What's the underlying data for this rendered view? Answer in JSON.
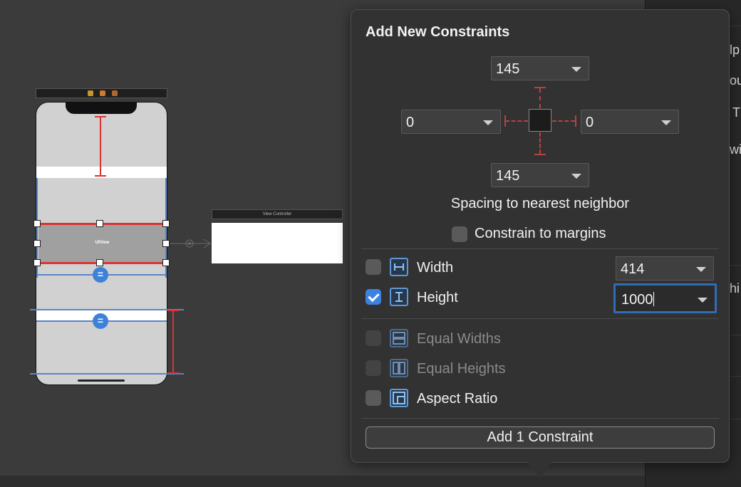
{
  "storyboard": {
    "uiview_label": "UIView",
    "view_controller_title": "View Controller",
    "equal_symbol": "="
  },
  "right_panel": {
    "fragments": [
      "lp",
      "ou",
      "T",
      "wi",
      "hi"
    ]
  },
  "popover": {
    "title": "Add New Constraints",
    "spacing": {
      "top": "145",
      "left": "0",
      "right": "0",
      "bottom": "145"
    },
    "spacing_caption": "Spacing to nearest neighbor",
    "constrain_to_margins": {
      "label": "Constrain to margins",
      "checked": false
    },
    "width": {
      "label": "Width",
      "checked": false,
      "value": "414"
    },
    "height": {
      "label": "Height",
      "checked": true,
      "value": "1000"
    },
    "equal_widths": {
      "label": "Equal Widths",
      "enabled": false
    },
    "equal_heights": {
      "label": "Equal Heights",
      "enabled": false
    },
    "aspect_ratio": {
      "label": "Aspect Ratio",
      "checked": false
    },
    "add_button": "Add 1 Constraint"
  },
  "colors": {
    "constraint_red": "#d33333",
    "constraint_blue": "#5a84c8",
    "accent_blue": "#3d82e0"
  }
}
